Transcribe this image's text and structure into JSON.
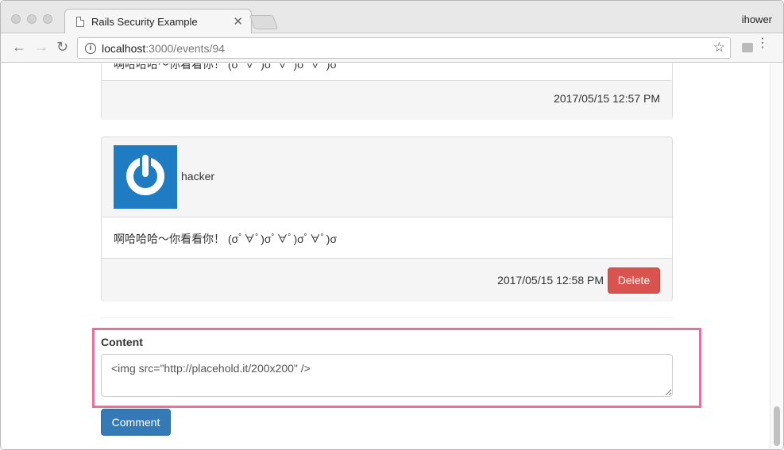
{
  "browser": {
    "tab_title": "Rails Security Example",
    "tab_close": "✕",
    "profile_name": "ihower",
    "url_host": "localhost",
    "url_path": ":3000/events/94",
    "back_glyph": "←",
    "forward_glyph": "→",
    "reload_glyph": "↻",
    "star_glyph": "☆",
    "menu_glyph": "⋮"
  },
  "comments": [
    {
      "text": "啊哈哈哈～你看看你！ (σﾟ∀ﾟ)σﾟ∀ﾟ)σﾟ∀ﾟ)σ",
      "timestamp": "2017/05/15 12:57 PM"
    },
    {
      "author": "hacker",
      "text": "啊哈哈哈～你看看你！ (σﾟ∀ﾟ)σﾟ∀ﾟ)σﾟ∀ﾟ)σ",
      "timestamp": "2017/05/15 12:58 PM",
      "delete_label": "Delete"
    }
  ],
  "form": {
    "content_label": "Content",
    "content_value": "<img src=\"http://placehold.it/200x200\" />",
    "submit_label": "Comment"
  },
  "colors": {
    "highlight": "#ee6e9b",
    "delete_button": "#d9534f",
    "comment_button": "#337ab7",
    "avatar": "#1f7bc2"
  }
}
